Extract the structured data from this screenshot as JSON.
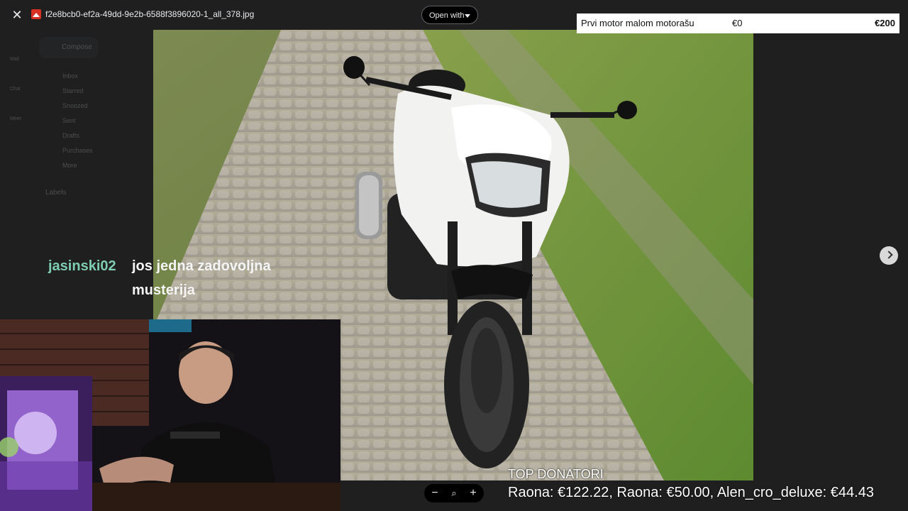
{
  "viewer": {
    "close_icon": "close-icon",
    "filename": "f2e8bcb0-ef2a-49dd-9e2b-6588f3896020-1_all_378.jpg",
    "open_with_label": "Open with",
    "next_icon": "chevron-right-icon"
  },
  "background_gmail": {
    "compose_label": "Compose",
    "rail": [
      "Mail",
      "Chat",
      "Meet"
    ],
    "items": [
      "Inbox",
      "Starred",
      "Snoozed",
      "Sent",
      "Drafts",
      "Purchases",
      "More"
    ],
    "labels_heading": "Labels"
  },
  "overlay": {
    "goal": {
      "title": "Prvi motor malom motorašu",
      "current": "€0",
      "target": "€200"
    },
    "chat": {
      "username": "jasinski02",
      "message": "jos jedna zadovoljna musterija"
    },
    "donors": {
      "title": "TOP DONATORI",
      "list": "Raona: €122.22, Raona: €50.00, Alen_cro_deluxe: €44.43"
    }
  },
  "zoom": {
    "minus": "−",
    "plus": "+"
  },
  "colors": {
    "chat_username": "#7ecdb0",
    "bike": "#f2f2f0",
    "grass": "#6a8a3a"
  }
}
